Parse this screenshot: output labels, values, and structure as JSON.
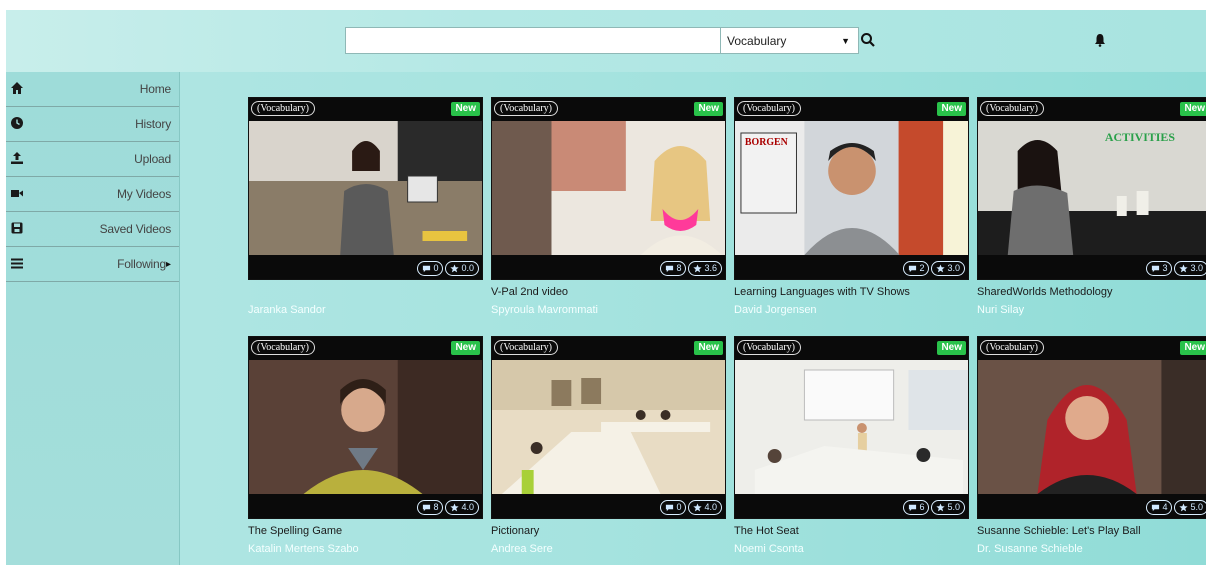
{
  "search": {
    "value": "",
    "placeholder": ""
  },
  "category_select": {
    "selected": "Vocabulary"
  },
  "sidebar": {
    "items": [
      {
        "label": "Home",
        "icon": "home-icon"
      },
      {
        "label": "History",
        "icon": "clock-icon"
      },
      {
        "label": "Upload",
        "icon": "upload-icon"
      },
      {
        "label": "My Videos",
        "icon": "video-camera-icon"
      },
      {
        "label": "Saved Videos",
        "icon": "save-icon"
      },
      {
        "label": "Following",
        "icon": "list-icon",
        "arrow": "▸"
      }
    ]
  },
  "videos": [
    {
      "tag": "Vocabulary",
      "badge": "New",
      "comments": "0",
      "rating": "0.0",
      "title": "",
      "author": "Jaranka Sandor"
    },
    {
      "tag": "Vocabulary",
      "badge": "New",
      "comments": "8",
      "rating": "3.6",
      "title": "V-Pal 2nd video",
      "author": "Spyroula Mavrommati"
    },
    {
      "tag": "Vocabulary",
      "badge": "New",
      "comments": "2",
      "rating": "3.0",
      "title": "Learning Languages with TV Shows",
      "author": "David Jorgensen"
    },
    {
      "tag": "Vocabulary",
      "badge": "New",
      "comments": "3",
      "rating": "3.0",
      "title": "SharedWorlds Methodology",
      "author": "Nuri Silay"
    },
    {
      "tag": "Vocabulary",
      "badge": "New",
      "comments": "8",
      "rating": "4.0",
      "title": "The Spelling Game",
      "author": "Katalin Mertens Szabo"
    },
    {
      "tag": "Vocabulary",
      "badge": "New",
      "comments": "0",
      "rating": "4.0",
      "title": "Pictionary",
      "author": "Andrea Sere"
    },
    {
      "tag": "Vocabulary",
      "badge": "New",
      "comments": "6",
      "rating": "5.0",
      "title": "The Hot Seat",
      "author": "Noemi Csonta"
    },
    {
      "tag": "Vocabulary",
      "badge": "New",
      "comments": "4",
      "rating": "5.0",
      "title": "Susanne Schieble: Let's Play Ball",
      "author": "Dr. Susanne Schieble"
    }
  ],
  "thumb_labels": {
    "borgen_poster": "BORGEN",
    "activities_text": "ACTIVITIES"
  }
}
